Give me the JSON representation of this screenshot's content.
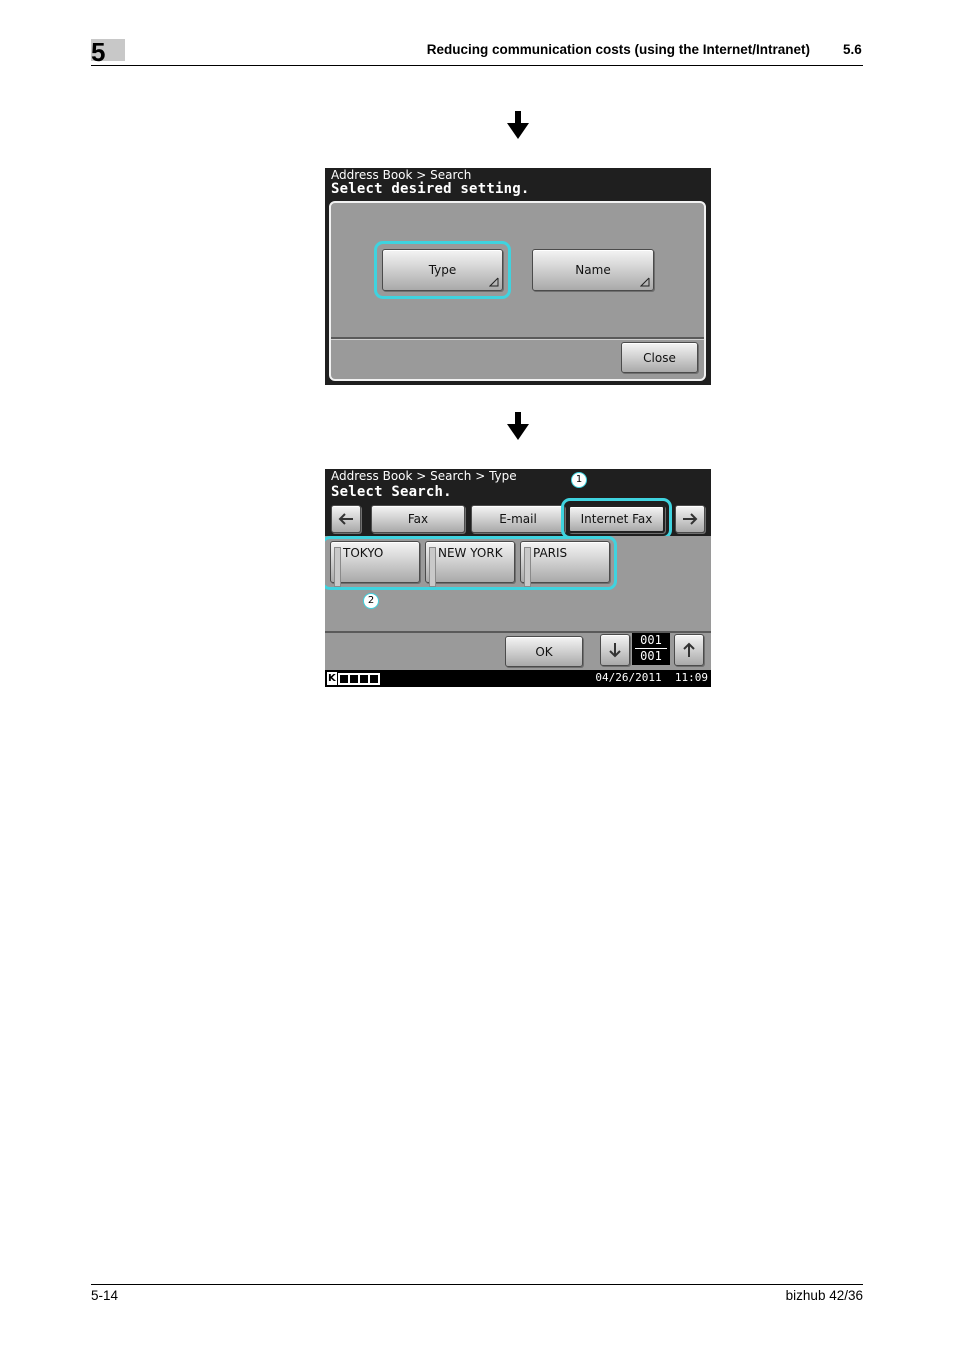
{
  "header": {
    "chapter_number": "5",
    "title": "Reducing communication costs (using the Internet/Intranet)",
    "section": "5.6"
  },
  "screen1": {
    "breadcrumb": "Address Book > Search",
    "prompt": "Select desired setting.",
    "buttons": {
      "type": "Type",
      "name": "Name",
      "close": "Close"
    }
  },
  "screen2": {
    "breadcrumb": "Address Book > Search > Type",
    "prompt": "Select Search.",
    "tabs": [
      "Fax",
      "E-mail",
      "Internet Fax"
    ],
    "destinations": [
      "TOKYO",
      "NEW YORK",
      "PARIS"
    ],
    "ok_label": "OK",
    "page_current": "001",
    "page_total": "001",
    "callouts": [
      "1",
      "2"
    ],
    "status_k": "K",
    "datetime": "04/26/2011  11:09"
  },
  "footer": {
    "page": "5-14",
    "product": "bizhub 42/36"
  },
  "colors": {
    "highlight": "#3fd3df",
    "panel_dark": "#1f1f1f",
    "panel_gray": "#9a9a9a"
  }
}
